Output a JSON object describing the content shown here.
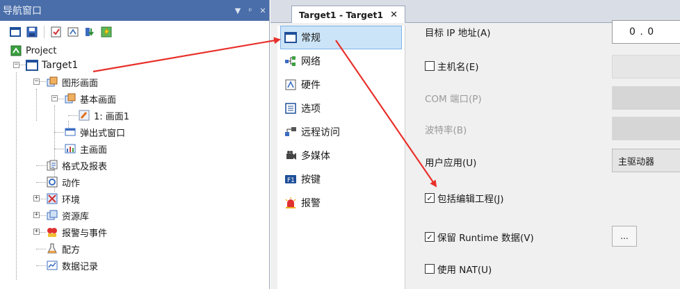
{
  "nav": {
    "title": "导航窗口",
    "controls": [
      "▼",
      "ᵖ",
      "✕"
    ],
    "tree": {
      "root": "Project",
      "target": "Target1",
      "graphics": "图形画面",
      "basic_screens": "基本画面",
      "screen1": "1: 画面1",
      "popup_window": "弹出式窗口",
      "main_screen": "主画面",
      "format_report": "格式及报表",
      "action": "动作",
      "environment": "环境",
      "resource_lib": "资源库",
      "alarm_event": "报警与事件",
      "recipe": "配方",
      "data_log": "数据记录"
    }
  },
  "editor": {
    "tab_label": "Target1 - Target1",
    "tab_close": "✕",
    "categories": [
      {
        "label": "常规",
        "icon": "general-icon"
      },
      {
        "label": "网络",
        "icon": "network-icon"
      },
      {
        "label": "硬件",
        "icon": "hardware-icon"
      },
      {
        "label": "选项",
        "icon": "options-icon"
      },
      {
        "label": "远程访问",
        "icon": "remote-access-icon"
      },
      {
        "label": "多媒体",
        "icon": "multimedia-icon"
      },
      {
        "label": "按键",
        "icon": "keys-icon"
      },
      {
        "label": "报警",
        "icon": "alarm-icon"
      }
    ],
    "props": {
      "target_ip_label": "目标 IP 地址(A)",
      "target_ip_value": "0 . 0",
      "hostname_label": "主机名(E)",
      "com_port_label": "COM 端口(P)",
      "baud_rate_label": "波特率(B)",
      "user_app_label": "用户应用(U)",
      "user_app_value": "主驱动器",
      "include_project_label": "包括编辑工程(J)",
      "keep_runtime_label": "保留 Runtime 数据(V)",
      "more_button": "...",
      "use_nat_label": "使用 NAT(U)"
    }
  },
  "colors": {
    "nav_title_bg": "#4a6ea9",
    "selection_bg": "#cce4f7",
    "arrow": "#e8302a"
  }
}
